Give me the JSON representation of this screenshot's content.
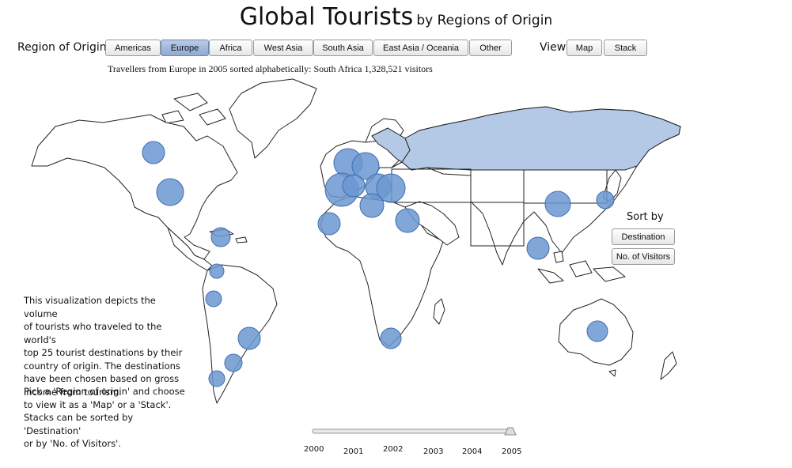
{
  "title": {
    "main": "Global Tourists",
    "sub": "by Regions of Origin"
  },
  "region_label": "Region of Origin",
  "regions": [
    "Americas",
    "Europe",
    "Africa",
    "West Asia",
    "South Asia",
    "East Asia / Oceania",
    "Other"
  ],
  "selected_region": "Europe",
  "view": {
    "label": "View",
    "options": [
      "Map",
      "Stack"
    ]
  },
  "caption": "Travellers from Europe in 2005 sorted alphabetically: South Africa 1,328,521 visitors",
  "description": {
    "p1": [
      "This visualization depicts the volume",
      "of tourists who traveled to the world's",
      "top 25 tourist destinations by their",
      "country of origin. The destinations",
      "have been chosen based on gross",
      "income from tourism."
    ],
    "p2": [
      "Pick a 'Region of origin' and choose",
      "to view it as a 'Map' or a 'Stack'.",
      "Stacks can be sorted by 'Destination'",
      "or by 'No. of Visitors'."
    ]
  },
  "sort": {
    "label": "Sort by",
    "options": [
      "Destination",
      "No. of Visitors"
    ]
  },
  "timeline": {
    "years": [
      "2000",
      "2001",
      "2002",
      "2003",
      "2004",
      "2005"
    ],
    "selected": "2005"
  },
  "colors": {
    "bubble": "#6b97d1",
    "region_highlight": "#b3c9e6",
    "active_button": "#9fb6da"
  }
}
